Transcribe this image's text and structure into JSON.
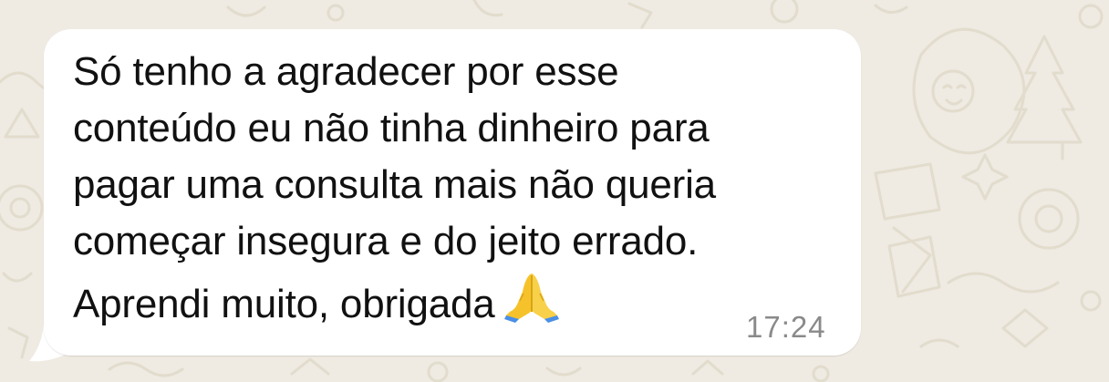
{
  "chat": {
    "background_color": "#efeae2",
    "message": {
      "bubble_color": "#ffffff",
      "text_color": "#111111",
      "lines": [
        "Só tenho a agradecer por esse",
        "conteúdo eu não tinha dinheiro para",
        "pagar uma consulta mais não queria",
        "começar insegura e do jeito errado.",
        "Aprendi muito, obrigada"
      ],
      "emoji_icon": "folded-hands-icon",
      "time": "17:24"
    }
  }
}
